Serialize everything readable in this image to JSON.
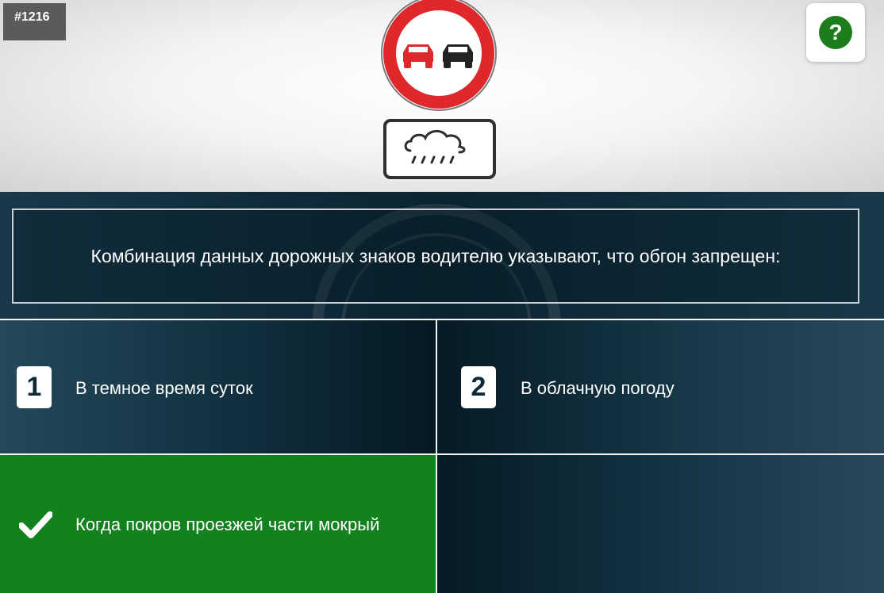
{
  "question": {
    "id_label": "#1216",
    "text": "Комбинация данных дорожных знаков водителю указывают, что обгон запрещен:"
  },
  "help": {
    "icon": "question-icon",
    "label": "?"
  },
  "signs": {
    "main": "no-overtaking-sign",
    "plate": "rain-plate",
    "colors": {
      "ring": "#e0272c",
      "left_car": "#e0272c",
      "right_car": "#222222"
    }
  },
  "answers": [
    {
      "number": "1",
      "text": "В темное время суток",
      "state": "default"
    },
    {
      "number": "2",
      "text": "В облачную погоду",
      "state": "default"
    },
    {
      "number": "",
      "text": "Когда покров проезжей части мокрый",
      "state": "correct",
      "icon": "checkmark-icon"
    },
    {
      "number": "",
      "text": "",
      "state": "empty"
    }
  ],
  "colors": {
    "correct": "#14811f",
    "panel": "#0c2431",
    "accent": "#1b7d1b"
  }
}
